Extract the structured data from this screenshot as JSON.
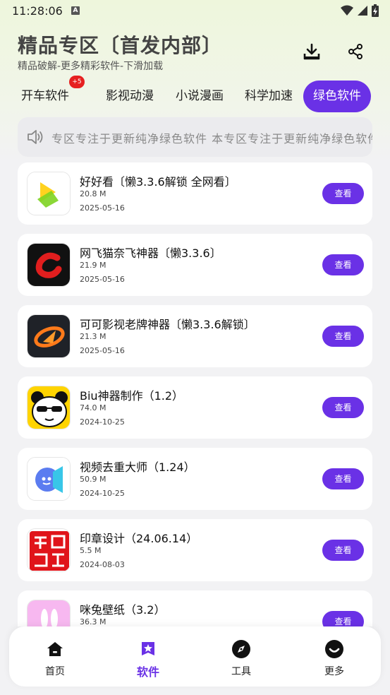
{
  "status_bar": {
    "time": "11:28:06",
    "notification_letter": "A"
  },
  "header": {
    "title": "精品专区〔首发内部〕",
    "subtitle": "精品破解-更多精彩软件-下滑加载"
  },
  "tabs": [
    {
      "label": "开车软件",
      "badge": "+5"
    },
    {
      "label": "影视动漫"
    },
    {
      "label": "小说漫画"
    },
    {
      "label": "科学加速"
    },
    {
      "label": "绿色软件",
      "active": true
    }
  ],
  "notice": {
    "text": "专区专注于更新纯净绿色软件    本专区专注于更新纯净绿色软件"
  },
  "apps": [
    {
      "name": "好好看〔懒3.3.6解锁 全网看〕",
      "size": "20.8 M",
      "date": "2025-05-16",
      "icon": "haohaokan-icon",
      "button": "查看"
    },
    {
      "name": "网飞猫奈飞神器〔懒3.3.6〕",
      "size": "21.9 M",
      "date": "2025-05-16",
      "icon": "netflix-cat-icon",
      "button": "查看"
    },
    {
      "name": "可可影视老牌神器〔懒3.3.6解锁〕",
      "size": "21.3 M",
      "date": "2025-05-16",
      "icon": "keke-video-icon",
      "button": "查看"
    },
    {
      "name": "Biu神器制作（1.2）",
      "size": "74.0 M",
      "date": "2024-10-25",
      "icon": "panda-icon",
      "button": "查看"
    },
    {
      "name": "视频去重大师（1.24）",
      "size": "50.9 M",
      "date": "2024-10-25",
      "icon": "video-dedup-icon",
      "button": "查看"
    },
    {
      "name": "印章设计（24.06.14）",
      "size": "5.5 M",
      "date": "2024-08-03",
      "icon": "seal-design-icon",
      "button": "查看"
    },
    {
      "name": "咪兔壁纸（3.2）",
      "size": "36.3 M",
      "date": "",
      "icon": "mitu-wallpaper-icon",
      "button": "查看"
    }
  ],
  "bottom_nav": [
    {
      "label": "首页",
      "icon": "home-icon"
    },
    {
      "label": "软件",
      "icon": "software-star-icon",
      "active": true
    },
    {
      "label": "工具",
      "icon": "compass-icon"
    },
    {
      "label": "更多",
      "icon": "smile-icon"
    }
  ],
  "colors": {
    "accent": "#6a31e6",
    "badge": "#e62020"
  }
}
